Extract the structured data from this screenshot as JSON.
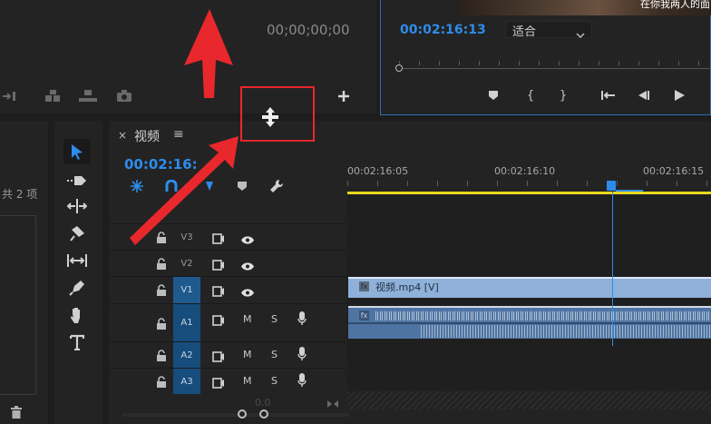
{
  "source_panel": {
    "timecode": "00;00;00;00"
  },
  "program_monitor": {
    "timecode": "00:02:16:13",
    "zoom_select": "适合",
    "overlay_text": "在你我两人的面"
  },
  "project_panel": {
    "items_count": "共 2 项"
  },
  "timeline": {
    "close_label": "×",
    "tab_title": "视频",
    "menu_label": "≡",
    "current_timecode": "00:02:16:",
    "ruler": [
      "00:02:16:05",
      "00:02:16:10",
      "00:02:16:15"
    ],
    "tracks": [
      {
        "name": "V3",
        "type": "video"
      },
      {
        "name": "V2",
        "type": "video"
      },
      {
        "name": "V1",
        "type": "video"
      },
      {
        "name": "A1",
        "type": "audio",
        "m": "M",
        "s": "S"
      },
      {
        "name": "A2",
        "type": "audio",
        "m": "M",
        "s": "S"
      },
      {
        "name": "A3",
        "type": "audio",
        "m": "M",
        "s": "S"
      }
    ],
    "video_clip_label": "视频.mp4 [V]",
    "fx_label": "fx",
    "bottom_value": "0.0"
  },
  "colors": {
    "accent": "#2d8ceb",
    "annotation": "#e8282c",
    "clip_video": "#8fb1d9",
    "clip_audio": "#4e74a3",
    "work_area": "#e8d81f"
  }
}
